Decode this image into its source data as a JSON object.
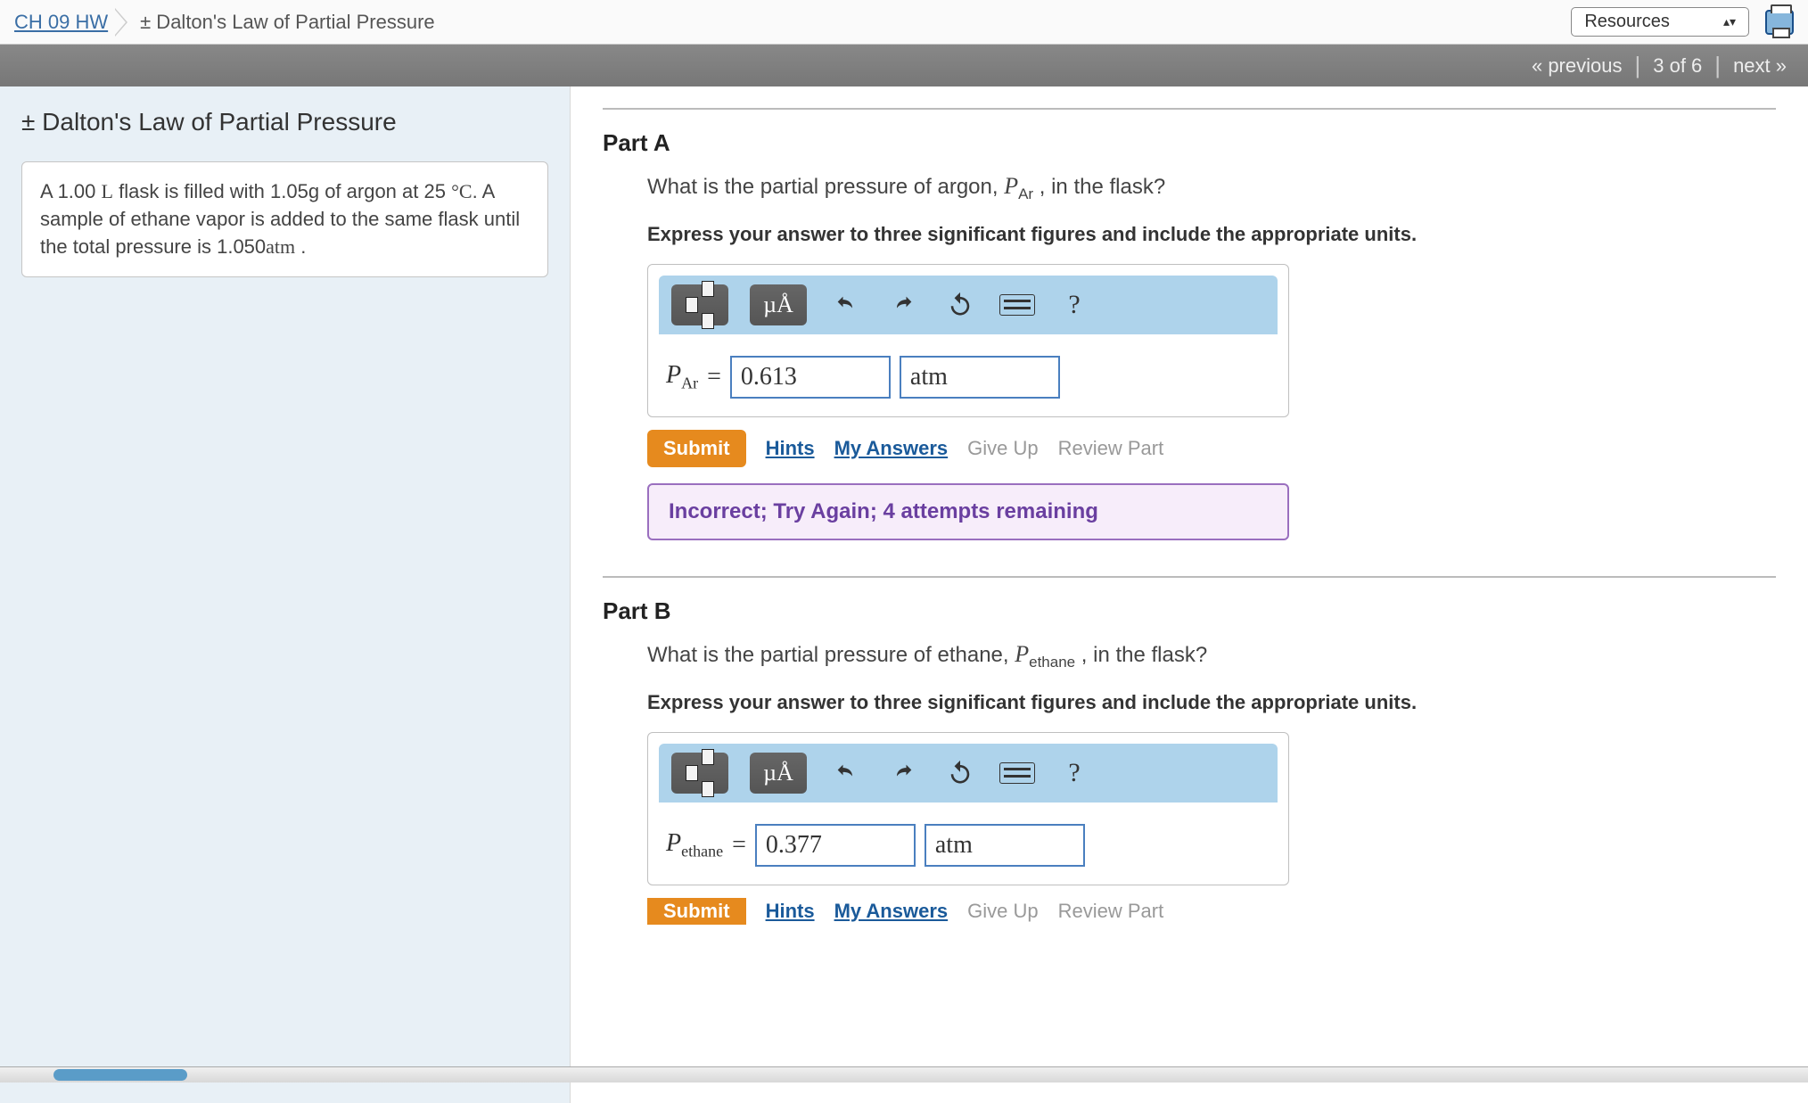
{
  "header": {
    "hw_link": "CH 09 HW",
    "title": "± Dalton's Law of Partial Pressure",
    "resources": "Resources"
  },
  "nav": {
    "prev": "« previous",
    "position": "3 of 6",
    "next": "next »"
  },
  "left": {
    "heading": "± Dalton's Law of Partial Pressure",
    "desc_pre": "A 1.00 ",
    "desc_L": "L",
    "desc_mid1": " flask is filled with 1.05g of argon at 25 ",
    "desc_deg": "°C",
    "desc_mid2": ". A sample of ethane vapor is added to the same flask until the total pressure is 1.050",
    "desc_atm": "atm",
    "desc_end": " ."
  },
  "partA": {
    "label": "Part A",
    "question_pre": "What is the partial pressure of argon, ",
    "var_html": "P",
    "var_sub": "Ar",
    "question_post": " , in the flask?",
    "instruction": "Express your answer to three significant figures and include the appropriate units.",
    "answer_var": "P",
    "answer_sub": "Ar",
    "value": "0.613",
    "unit": "atm",
    "submit": "Submit",
    "hints": "Hints",
    "myanswers": "My Answers",
    "giveup": "Give Up",
    "review": "Review Part",
    "feedback": "Incorrect; Try Again; 4 attempts remaining"
  },
  "partB": {
    "label": "Part B",
    "question_pre": "What is the partial pressure of ethane, ",
    "var_html": "P",
    "var_sub": "ethane",
    "question_post": " , in the flask?",
    "instruction": "Express your answer to three significant figures and include the appropriate units.",
    "answer_var": "P",
    "answer_sub": "ethane",
    "value": "0.377",
    "unit": "atm",
    "submit": "Submit",
    "hints": "Hints",
    "myanswers": "My Answers",
    "giveup": "Give Up",
    "review": "Review Part"
  },
  "toolbar": {
    "units_label": "µÅ",
    "help": "?"
  }
}
